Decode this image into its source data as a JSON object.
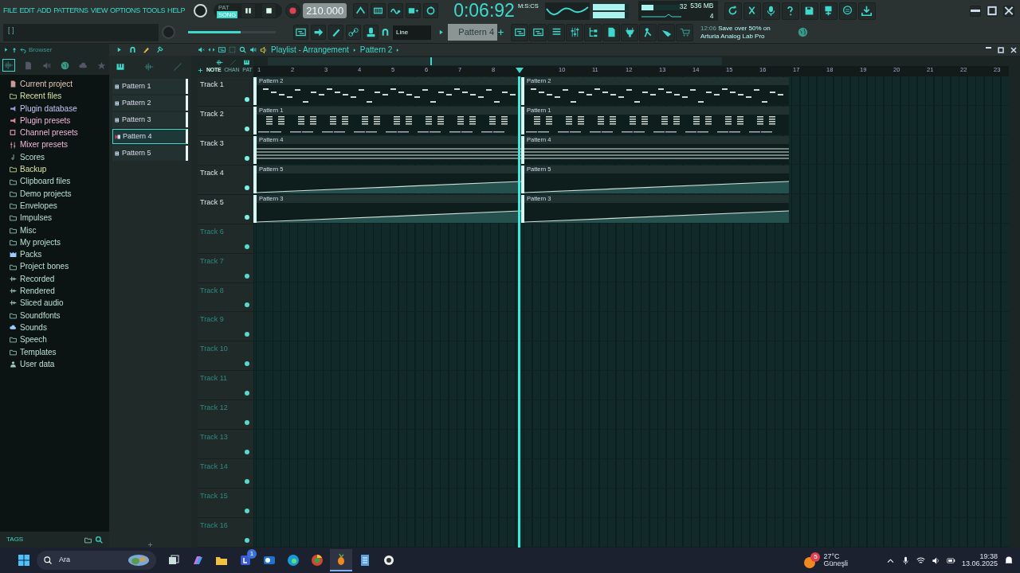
{
  "menu": [
    "FILE",
    "EDIT",
    "ADD",
    "PATTERNS",
    "VIEW",
    "OPTIONS",
    "TOOLS",
    "HELP"
  ],
  "hint_bar": "[ ]",
  "transport": {
    "modes": [
      {
        "label": "PAT",
        "selected": false
      },
      {
        "label": "SONG",
        "selected": true
      }
    ],
    "tempo": "210.000",
    "time": "0:06:92",
    "time_unit": "M:S:CS"
  },
  "master_volume": {
    "level": 0.6
  },
  "peak_meters": [
    {
      "level": 0.9
    },
    {
      "level": 0.9
    }
  ],
  "monitor": {
    "cpu": "32",
    "memory": "536 MB",
    "voices": "4",
    "meter": {
      "level": 0.3
    }
  },
  "snap": "Line",
  "pattern_selector": "Pattern 4",
  "news": {
    "time": "12:06",
    "text": "Save over 50% on Arturia Analog Lab Pro"
  },
  "browser": {
    "title": "Browser",
    "tags_label": "TAGS",
    "items": [
      {
        "label": "Current project",
        "kind": "project"
      },
      {
        "label": "Recent files",
        "kind": "recent"
      },
      {
        "label": "Plugin database",
        "kind": "plugin"
      },
      {
        "label": "Plugin presets",
        "kind": "preset"
      },
      {
        "label": "Channel presets",
        "kind": "channel"
      },
      {
        "label": "Mixer presets",
        "kind": "mixer"
      },
      {
        "label": "Scores",
        "kind": "score"
      },
      {
        "label": "Backup",
        "kind": "recent"
      },
      {
        "label": "Clipboard files",
        "kind": "folder"
      },
      {
        "label": "Demo projects",
        "kind": "folder"
      },
      {
        "label": "Envelopes",
        "kind": "folder"
      },
      {
        "label": "Impulses",
        "kind": "folder"
      },
      {
        "label": "Misc",
        "kind": "folder"
      },
      {
        "label": "My projects",
        "kind": "folder"
      },
      {
        "label": "Packs",
        "kind": "packs"
      },
      {
        "label": "Project bones",
        "kind": "folder"
      },
      {
        "label": "Recorded",
        "kind": "audio"
      },
      {
        "label": "Rendered",
        "kind": "audio"
      },
      {
        "label": "Sliced audio",
        "kind": "audio"
      },
      {
        "label": "Soundfonts",
        "kind": "folder"
      },
      {
        "label": "Sounds",
        "kind": "cloud"
      },
      {
        "label": "Speech",
        "kind": "folder"
      },
      {
        "label": "Templates",
        "kind": "folder"
      },
      {
        "label": "User data",
        "kind": "user"
      }
    ]
  },
  "patterns": [
    {
      "label": "Pattern 1",
      "selected": false
    },
    {
      "label": "Pattern 2",
      "selected": false
    },
    {
      "label": "Pattern 3",
      "selected": false
    },
    {
      "label": "Pattern 4",
      "selected": true
    },
    {
      "label": "Pattern 5",
      "selected": false
    }
  ],
  "playlist": {
    "title": "Playlist - Arrangement",
    "pattern": "Pattern 2",
    "header_tabs": [
      "NOTE",
      "CHAN",
      "PAT"
    ],
    "ruler_before_playhead": [
      "1",
      "2",
      "3",
      "4",
      "5",
      "6",
      "7",
      "8"
    ],
    "ruler_after_playhead": [
      "10",
      "11",
      "12",
      "13",
      "14",
      "15",
      "16",
      "17",
      "18",
      "19",
      "20",
      "21",
      "22",
      "23"
    ],
    "playhead": {
      "level": 0.343
    },
    "tracks": [
      {
        "label": "Track 1",
        "clips": [
          {
            "label": "Pattern 2",
            "kind": "melody"
          },
          {
            "label": "Pattern 2",
            "kind": "melody"
          }
        ]
      },
      {
        "label": "Track 2",
        "clips": [
          {
            "label": "Pattern 1",
            "kind": "chords"
          },
          {
            "label": "Pattern 1",
            "kind": "chords"
          }
        ]
      },
      {
        "label": "Track 3",
        "clips": [
          {
            "label": "Pattern 4",
            "kind": "pad"
          },
          {
            "label": "Pattern 4",
            "kind": "pad"
          }
        ]
      },
      {
        "label": "Track 4",
        "clips": [
          {
            "label": "Pattern 5",
            "kind": "ramp"
          },
          {
            "label": "Pattern 5",
            "kind": "ramp"
          }
        ]
      },
      {
        "label": "Track 5",
        "clips": [
          {
            "label": "Pattern 3",
            "kind": "ramp"
          },
          {
            "label": "Pattern 3",
            "kind": "ramp"
          }
        ]
      },
      {
        "label": "Track 6"
      },
      {
        "label": "Track 7"
      },
      {
        "label": "Track 8"
      },
      {
        "label": "Track 9"
      },
      {
        "label": "Track 10"
      },
      {
        "label": "Track 11"
      },
      {
        "label": "Track 12"
      },
      {
        "label": "Track 13"
      },
      {
        "label": "Track 14"
      },
      {
        "label": "Track 15"
      },
      {
        "label": "Track 16"
      }
    ]
  },
  "taskbar": {
    "search_placeholder": "Ara",
    "app_badge": "1",
    "weather": {
      "badge": "5",
      "temperature": "27°C",
      "condition": "Güneşli"
    },
    "clock": {
      "time": "19:38",
      "date": "13.06.2025"
    }
  }
}
